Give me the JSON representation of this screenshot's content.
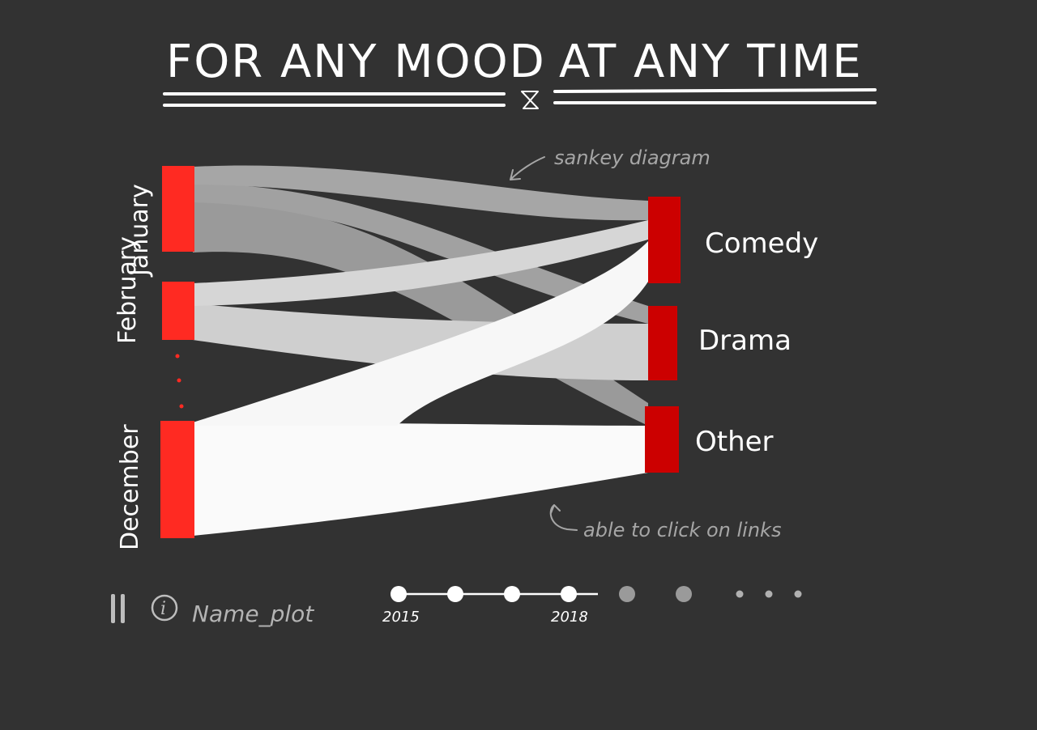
{
  "title": {
    "part1": "FOR ANY MOOD",
    "part2": "AT ANY TIME",
    "divider_icon": "hourglass-icon"
  },
  "sources": [
    {
      "id": "january",
      "label": "January"
    },
    {
      "id": "february",
      "label": "February"
    },
    {
      "id": "december",
      "label": "December"
    }
  ],
  "targets": [
    {
      "id": "comedy",
      "label": "Comedy"
    },
    {
      "id": "drama",
      "label": "Drama"
    },
    {
      "id": "other",
      "label": "Other"
    }
  ],
  "annotations": {
    "sankey_note": "sankey diagram",
    "links_note": "able to click on links"
  },
  "controls": {
    "pause_icon": "pause-icon",
    "info_icon": "info-icon",
    "info_glyph": "i",
    "plot_name": "Name_plot"
  },
  "timeline": {
    "start_label": "2015",
    "end_label": "2018",
    "active_dots": 4,
    "inactive_dots": 2,
    "more_dots": 3
  },
  "colors": {
    "background": "#323232",
    "source_node": "#ff2a22",
    "target_node": "#cc0000",
    "link_january": "#9f9f9f",
    "link_february": "#d4d4d4",
    "link_december": "#fafafa",
    "text": "#ffffff",
    "muted_text": "#a6a6a6"
  }
}
